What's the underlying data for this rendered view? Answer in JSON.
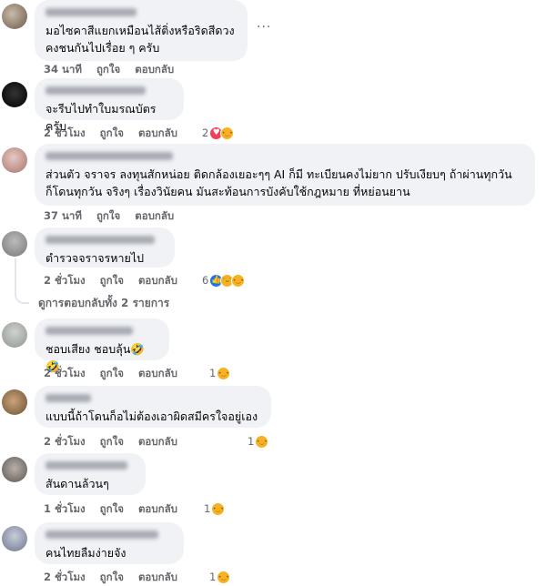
{
  "comments": [
    {
      "text": "มอไซคาสีแยกเหมือนไส้ติ่งหรือริดสีดวง\nคงชนกันไปเรื่อย ๆ ครับ",
      "time": "34 นาที",
      "like": "ถูกใจ",
      "reply": "ตอบกลับ",
      "count": "",
      "more": "···"
    },
    {
      "text": "จะรีบไปทำใบมรณบัตรครับ",
      "time": "2 ชั่วโมง",
      "like": "ถูกใจ",
      "reply": "ตอบกลับ",
      "count": "2"
    },
    {
      "text": "ส่วนตัว จราจร ลงทุนสักหน่อย ติดกล้องเยอะๆๆ AI ก็มี ทะเบียนคงไม่ยาก ปรับเงียบๆ ถ้าผ่านทุกวัน\nก็โดนทุกวัน จริงๆ เรื่องวินัยคน มันสะท้อนการบังคับใช้กฎหมาย ที่หย่อนยาน",
      "time": "37 นาที",
      "like": "ถูกใจ",
      "reply": "ตอบกลับ",
      "count": ""
    },
    {
      "text": "ตำรวจจราจรหายไป",
      "time": "2 ชั่วโมง",
      "like": "ถูกใจ",
      "reply": "ตอบกลับ",
      "count": "6"
    },
    {
      "text": "ชอบเสียง ชอบลุ้น🤣🤣",
      "time": "2 ชั่วโมง",
      "like": "ถูกใจ",
      "reply": "ตอบกลับ",
      "count": "1"
    },
    {
      "text": "แบบนี้ถ้าโดนก็อไม่ต้องเอาผิดสมีครใจอยู่เอง",
      "time": "2 ชั่วโมง",
      "like": "ถูกใจ",
      "reply": "ตอบกลับ",
      "count": "1"
    },
    {
      "text": "สันดานล้วนๆ",
      "time": "1 ชั่วโมง",
      "like": "ถูกใจ",
      "reply": "ตอบกลับ",
      "count": "1"
    },
    {
      "text": "คนไทยลืมง่ายจัง",
      "time": "2 ชั่วโมง",
      "like": "ถูกใจ",
      "reply": "ตอบกลับ",
      "count": "1"
    }
  ],
  "see_replies": "ดูการตอบกลับทั้ง 2 รายการ",
  "colors": {
    "bubble": "#f0f2f5",
    "meta": "#65676b",
    "text": "#050505",
    "like": "#1877f2",
    "love": "#f33e58",
    "sad": "#f7b125"
  }
}
